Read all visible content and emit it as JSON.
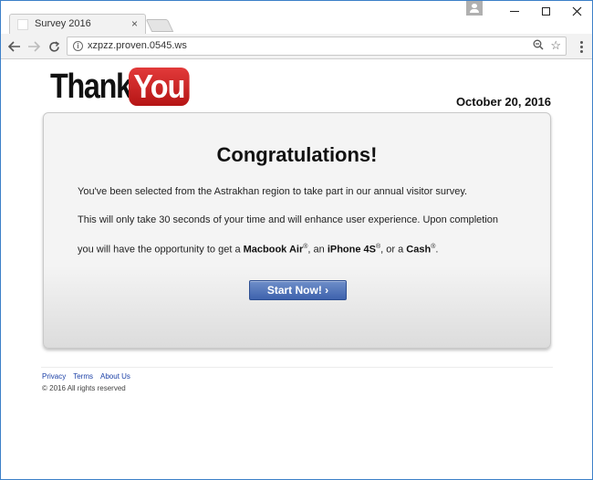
{
  "browser": {
    "tab_title": "Survey 2016",
    "tab_close": "×",
    "url": "xzpzz.proven.0545.ws"
  },
  "icons": {
    "back": "arrow-left",
    "forward": "arrow-right",
    "reload": "circular-arrow",
    "info": "info-circle",
    "zoom": "magnifier",
    "star": "bookmark-star",
    "menu": "vertical-dots"
  },
  "page": {
    "logo_thank": "Thank",
    "logo_you": "You",
    "date": "October 20, 2016",
    "card": {
      "title": "Congratulations!",
      "p1": "You've been selected from the Astrakhan region to take part in our annual visitor survey.",
      "p2": "This will only take 30 seconds of your time and will enhance user experience. Upon completion",
      "p3_prefix": "you will have the opportunity to get a ",
      "prize1": "Macbook Air",
      "sep1": ", an ",
      "prize2": "iPhone 4S",
      "sep2": ", or a ",
      "prize3": "Cash",
      "reg": "®",
      "p3_suffix": ".",
      "cta_label": "Start Now! ›"
    },
    "footer": {
      "links": [
        "Privacy",
        "Terms",
        "About Us"
      ],
      "copyright": "© 2016 All rights reserved"
    }
  },
  "colors": {
    "accent_blue": "#3e62ad",
    "logo_red": "#c61f1f",
    "link_blue": "#1a3fa6"
  }
}
